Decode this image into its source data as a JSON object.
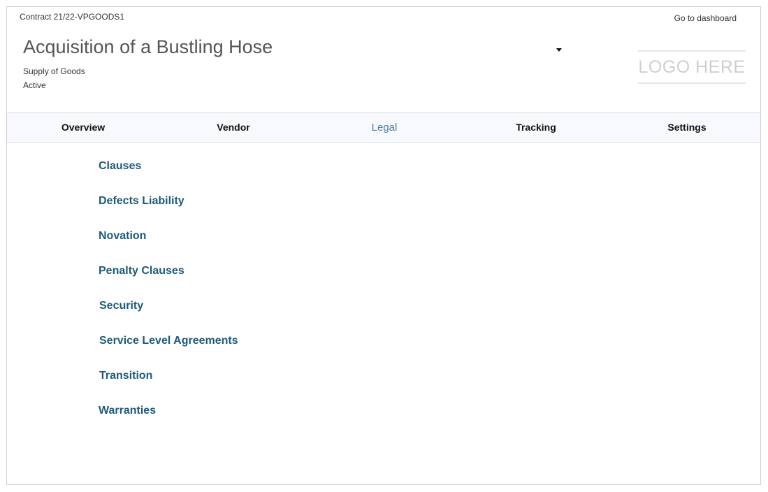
{
  "header": {
    "contract_id": "Contract 21/22-VPGOODS1",
    "dashboard_link": "Go to dashboard",
    "title": "Acquisition of a Bustling Hose",
    "category": "Supply of Goods",
    "status": "Active",
    "logo_text": "LOGO HERE",
    "dropdown_icon": "caret-down-icon"
  },
  "tabs": [
    {
      "label": "Overview",
      "active": false
    },
    {
      "label": "Vendor",
      "active": false
    },
    {
      "label": "Legal",
      "active": true
    },
    {
      "label": "Tracking",
      "active": false
    },
    {
      "label": "Settings",
      "active": false
    }
  ],
  "legal": {
    "items": [
      "Clauses",
      "Defects Liability",
      "Novation",
      "Penalty Clauses",
      "Security",
      "Service Level Agreements",
      "Transition",
      "Warranties"
    ]
  },
  "colors": {
    "link": "#1d5a7a",
    "active_tab": "#4a7fa8",
    "tabbar_bg": "#f7f9fc"
  }
}
